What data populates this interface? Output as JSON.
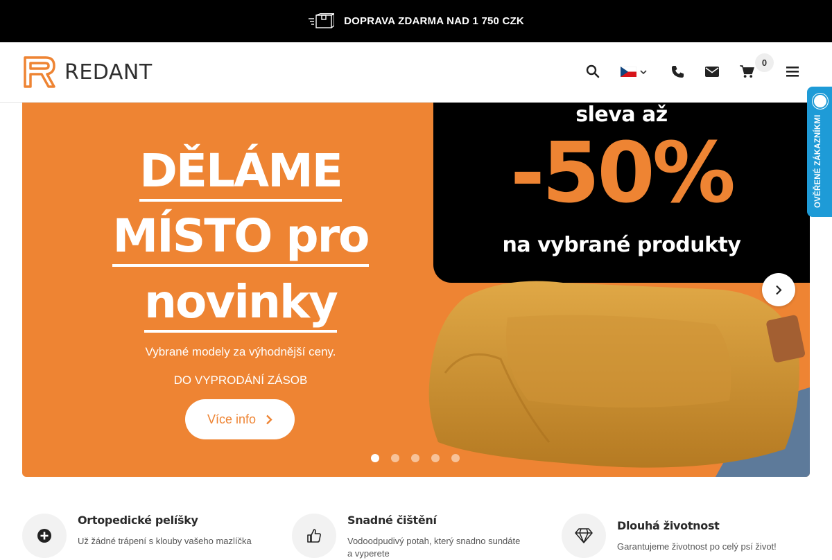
{
  "topbar": {
    "text": "DOPRAVA ZDARMA NAD 1 750 CZK",
    "icon": "delivery-box-icon"
  },
  "header": {
    "logo_text": "REDANT",
    "cart_count": "0",
    "icons": [
      "search-icon",
      "flag-cz-icon",
      "phone-icon",
      "mail-icon",
      "cart-icon",
      "menu-icon"
    ]
  },
  "hero": {
    "promo_top": "sleva až",
    "promo_value": "-50%",
    "promo_bottom": "na vybrané produkty",
    "headline_line1": "DĚLÁME",
    "headline_line2": "MÍSTO pro",
    "headline_line3": "novinky",
    "subtitle": "Vybrané modely za výhodnější ceny.",
    "note": "DO VYPRODÁNÍ ZÁSOB",
    "cta_label": "Více info",
    "slide_count": 5,
    "active_slide": 1
  },
  "badge": {
    "text": "OVĚŘENÉ ZÁKAZNÍKMI"
  },
  "features": [
    {
      "title": "Ortopedické pelíšky",
      "desc": "Už žádné trápení s klouby vašeho mazlíčka",
      "icon": "plus-circle-icon"
    },
    {
      "title": "Snadné čištění",
      "desc": "Vodoodpudivý potah, který snadno sundáte a vyperete",
      "icon": "thumbs-up-icon"
    },
    {
      "title": "Dlouhá životnost",
      "desc": "Garantujeme životnost po celý psí život!",
      "icon": "diamond-icon"
    }
  ],
  "colors": {
    "brand_orange": "#ee8433",
    "topbar_bg": "#000000",
    "badge_blue": "#1e9bd7"
  }
}
